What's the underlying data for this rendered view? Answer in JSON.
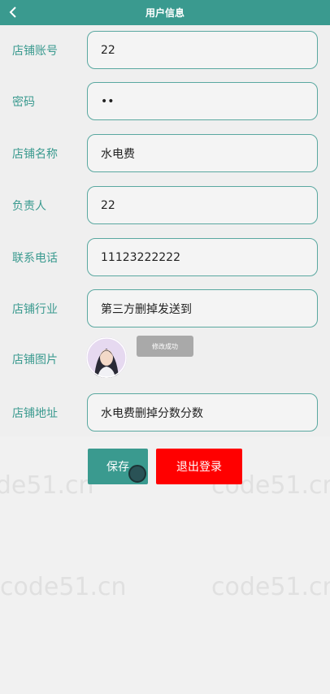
{
  "header": {
    "title": "用户信息",
    "back_icon": "chevron-left-icon"
  },
  "form": {
    "fields": [
      {
        "label": "店铺账号",
        "value": "22"
      },
      {
        "label": "密码",
        "value": "••"
      },
      {
        "label": "店铺名称",
        "value": "水电费"
      },
      {
        "label": "负责人",
        "value": "22"
      },
      {
        "label": "联系电话",
        "value": "11123222222"
      },
      {
        "label": "店铺行业",
        "value": "第三方删掉发送到"
      }
    ],
    "image": {
      "label": "店铺图片",
      "upload_label": "修改成功"
    },
    "address": {
      "label": "店铺地址",
      "value": "水电费删掉分数分数"
    }
  },
  "actions": {
    "save": "保存",
    "logout": "退出登录"
  },
  "watermark": "code51.cn",
  "colors": {
    "primary": "#3a9a8f",
    "danger": "#ff0000",
    "upload": "#a9a9a9"
  }
}
